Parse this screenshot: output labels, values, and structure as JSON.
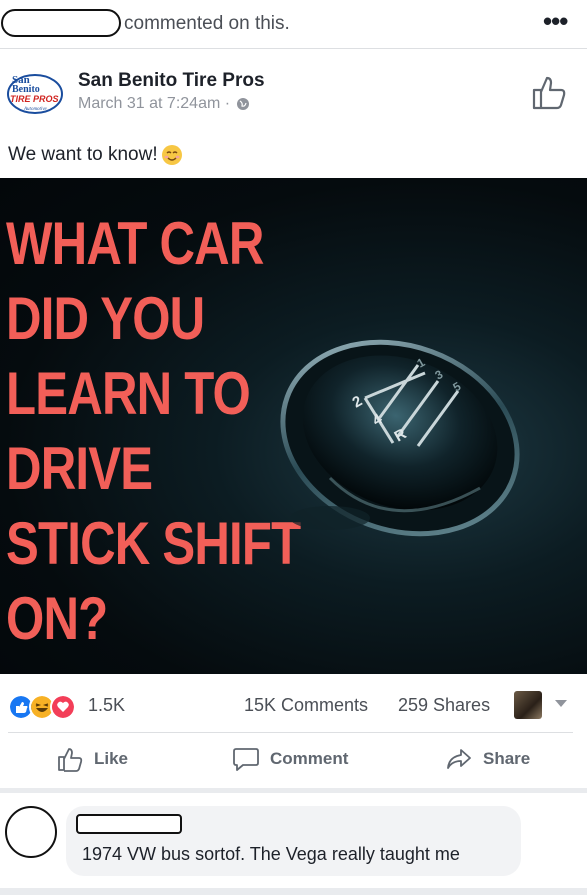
{
  "activity": {
    "suffix": "commented on this."
  },
  "post": {
    "page_name": "San Benito Tire Pros",
    "timestamp": "March 31 at 7:24am · ",
    "text": "We want to know!",
    "logo_text": [
      "San",
      "Benito",
      "TIRE PROS",
      "Automotive"
    ],
    "image_headline": [
      "WHAT CAR",
      "DID YOU",
      "LEARN TO",
      "DRIVE",
      "STICK SHIFT",
      "ON?"
    ],
    "shift_labels": [
      "2",
      "4",
      "R",
      "1",
      "3",
      "5"
    ]
  },
  "stats": {
    "reactions": "1.5K",
    "comments": "15K Comments",
    "shares": "259 Shares"
  },
  "actions": {
    "like": "Like",
    "comment": "Comment",
    "share": "Share"
  },
  "comment": {
    "text": "1974 VW bus sortof. The Vega really taught me"
  },
  "colors": {
    "headline": "#f25f58",
    "fb_blue": "#1877f2",
    "love_red": "#f33e58",
    "haha_yellow": "#f7b125"
  },
  "icons": [
    "more-icon",
    "globe-icon",
    "like-page-icon",
    "smile-emoji-icon",
    "like-reaction-icon",
    "haha-reaction-icon",
    "love-reaction-icon",
    "thumbs-up-icon",
    "comment-bubble-icon",
    "share-arrow-icon",
    "chevron-down-icon"
  ]
}
